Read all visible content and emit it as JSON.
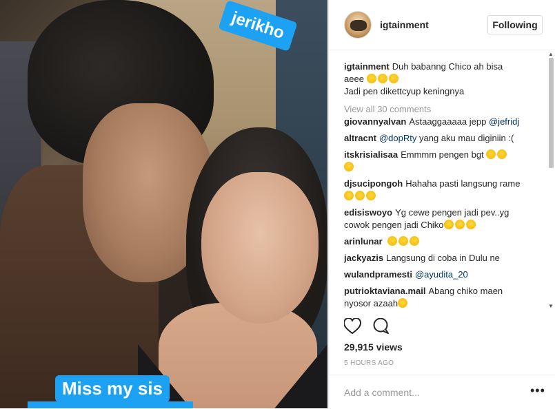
{
  "post": {
    "sticker_top": "jerikho",
    "sticker_bottom": "Miss my sis"
  },
  "header": {
    "username": "igtainment",
    "follow_label": "Following"
  },
  "caption": {
    "username": "igtainment",
    "line1": "Duh babanng Chico ah bisa",
    "line2": "aeee",
    "line3": "Jadi pen dikettcyup keningnya"
  },
  "view_all": "View all 30 comments",
  "comments": [
    {
      "user": "giovannyalvan",
      "text": "Astaaggaaaaa jepp",
      "mention": "@jefridj"
    },
    {
      "user": "altracnt",
      "text": "yang aku mau diginiin :(",
      "mention": "@dopRty"
    },
    {
      "user": "itskrisialisaa",
      "text": "Emmmm pengen bgt"
    },
    {
      "user": "djsucipongoh",
      "text": "Hahaha pasti langsung rame"
    },
    {
      "user": "edisiswoyo",
      "text": "Yg cewe pengen jadi pev..yg",
      "text2": "cowok pengen jadi Chiko"
    },
    {
      "user": "arinlunar",
      "text": ""
    },
    {
      "user": "jackyazis",
      "text": "Langsung di coba in Dulu ne"
    },
    {
      "user": "wulandpramesti",
      "text": "",
      "mention": "@ayudita_20"
    },
    {
      "user": "putrioktaviana.mail",
      "text": "Abang chiko maen",
      "text2": "nyosor azaah"
    }
  ],
  "stats": {
    "views": "29,915 views",
    "time": "5 HOURS AGO"
  },
  "add_comment": {
    "placeholder": "Add a comment..."
  },
  "icons": {
    "like": "heart-icon",
    "comment": "comment-icon",
    "more": "more-options-icon"
  },
  "colors": {
    "sticker": "#1da1f2",
    "mention": "#003569",
    "muted": "#999999"
  }
}
